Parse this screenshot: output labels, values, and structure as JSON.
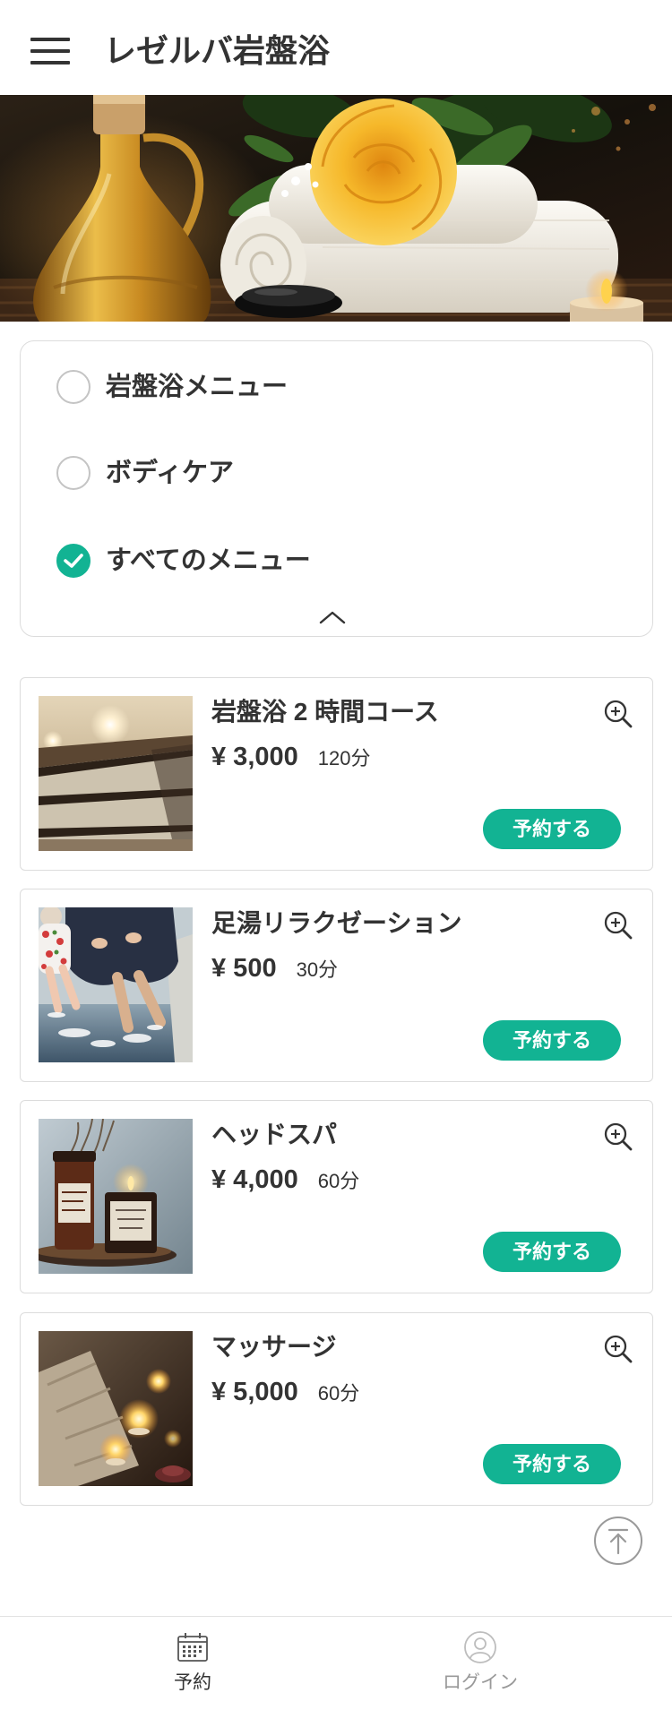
{
  "header": {
    "title": "レゼルバ岩盤浴",
    "menu_icon": "hamburger-menu-icon"
  },
  "filter": {
    "options": [
      {
        "label": "岩盤浴メニュー",
        "checked": false
      },
      {
        "label": "ボディケア",
        "checked": false
      },
      {
        "label": "すべてのメニュー",
        "checked": true
      }
    ],
    "collapse_icon": "chevron-up-icon"
  },
  "menu": {
    "reserve_label": "予約する",
    "detail_icon": "zoom-in-icon",
    "items": [
      {
        "title": "岩盤浴 2 時間コース",
        "price": "¥ 3,000",
        "duration": "120分"
      },
      {
        "title": "足湯リラクゼーション",
        "price": "¥ 500",
        "duration": "30分"
      },
      {
        "title": "ヘッドスパ",
        "price": "¥ 4,000",
        "duration": "60分"
      },
      {
        "title": "マッサージ",
        "price": "¥ 5,000",
        "duration": "60分"
      }
    ]
  },
  "scroll_top": {
    "icon": "scroll-to-top-icon"
  },
  "bottom_nav": {
    "items": [
      {
        "label": "予約",
        "icon": "calendar-icon",
        "active": true
      },
      {
        "label": "ログイン",
        "icon": "user-icon",
        "active": false
      }
    ]
  },
  "colors": {
    "accent": "#12b393",
    "text": "#333333",
    "muted": "#999999",
    "border": "#dcdcdc"
  }
}
